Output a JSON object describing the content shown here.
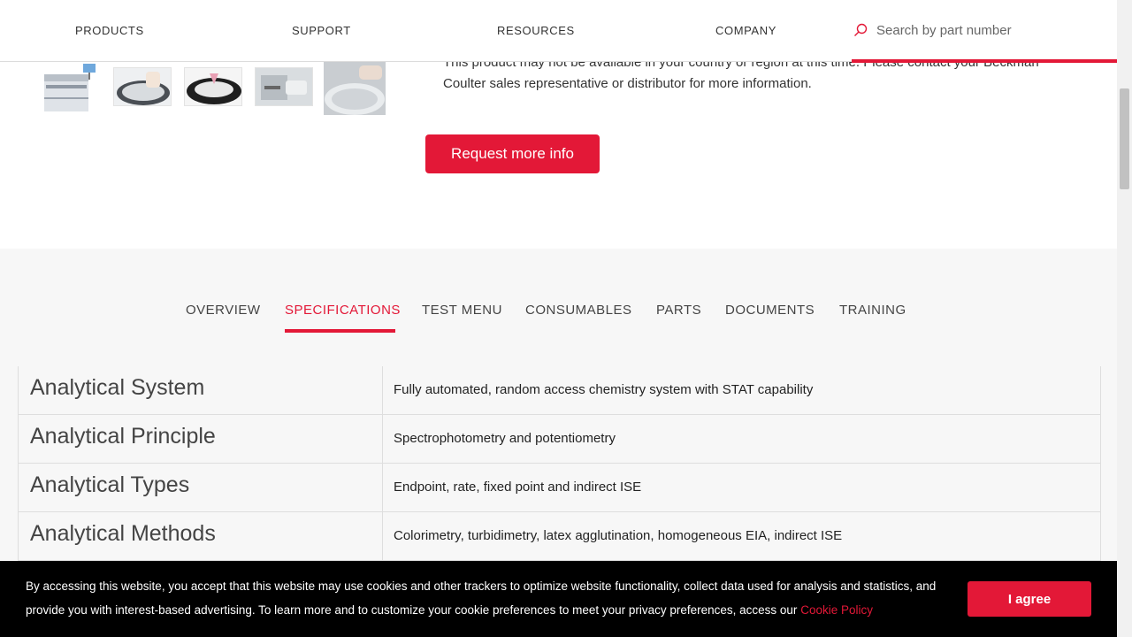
{
  "nav": {
    "items": [
      "PRODUCTS",
      "SUPPORT",
      "RESOURCES",
      "COMPANY"
    ],
    "search_placeholder": "Search by part number"
  },
  "product": {
    "notice": "This product may not be available in your country or region at this time. Please contact your Beckman Coulter sales representative or distributor for more information.",
    "request_button": "Request more info"
  },
  "tabs": {
    "items": [
      "OVERVIEW",
      "SPECIFICATIONS",
      "TEST MENU",
      "CONSUMABLES",
      "PARTS",
      "DOCUMENTS",
      "TRAINING"
    ],
    "active": "SPECIFICATIONS"
  },
  "specs": [
    {
      "label": "Analytical System",
      "value": "Fully automated, random access chemistry system with STAT capability"
    },
    {
      "label": "Analytical Principle",
      "value": "Spectrophotometry and potentiometry"
    },
    {
      "label": "Analytical Types",
      "value": "Endpoint, rate, fixed point and indirect ISE"
    },
    {
      "label": "Analytical Methods",
      "value": "Colorimetry, turbidimetry, latex agglutination, homogeneous EIA, indirect ISE"
    }
  ],
  "cookie": {
    "text": "By accessing this website, you accept that this website may use cookies and other trackers to optimize website functionality, collect data used for analysis and statistics, and provide you with interest-based advertising. To learn more and to customize your cookie preferences to meet your privacy preferences, access our",
    "link": "Cookie Policy",
    "agree_button": "I agree"
  },
  "colors": {
    "accent": "#e31837",
    "banner_bg": "#000000",
    "section_bg": "#f7f7f7"
  }
}
